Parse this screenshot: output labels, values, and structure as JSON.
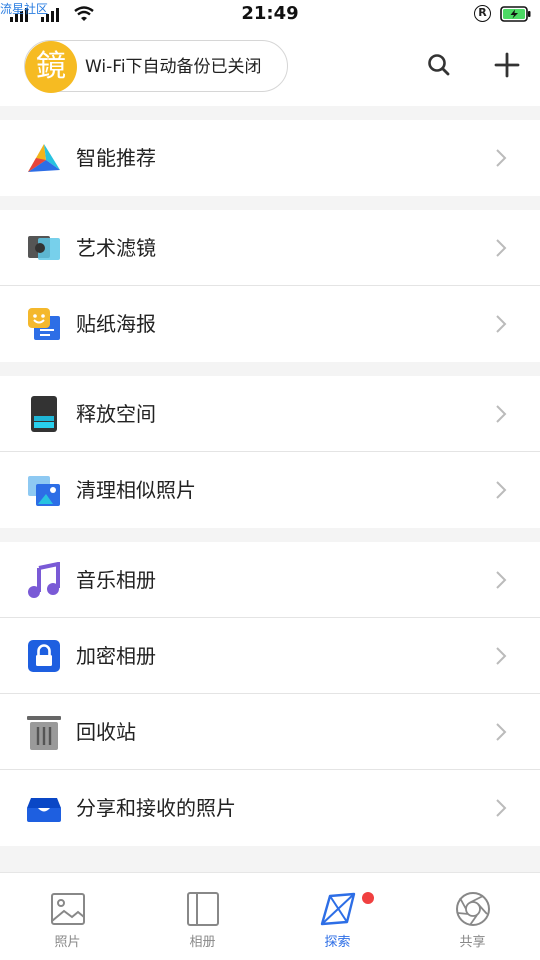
{
  "watermark": "流星社区",
  "status_bar": {
    "time": "21:49",
    "registered_mark": "R"
  },
  "header": {
    "avatar_char": "鏡",
    "backup_status": "Wi-Fi下自动备份已关闭",
    "search_icon": "search-icon",
    "add_icon": "plus-icon"
  },
  "groups": [
    {
      "items": [
        {
          "label": "智能推荐",
          "icon": "smart-recommend-icon"
        }
      ]
    },
    {
      "items": [
        {
          "label": "艺术滤镜",
          "icon": "art-filter-icon"
        },
        {
          "label": "贴纸海报",
          "icon": "sticker-poster-icon"
        }
      ]
    },
    {
      "items": [
        {
          "label": "释放空间",
          "icon": "free-space-icon"
        },
        {
          "label": "清理相似照片",
          "icon": "clean-similar-photos-icon"
        }
      ]
    },
    {
      "items": [
        {
          "label": "音乐相册",
          "icon": "music-album-icon"
        },
        {
          "label": "加密相册",
          "icon": "lock-album-icon"
        },
        {
          "label": "回收站",
          "icon": "trash-icon"
        },
        {
          "label": "分享和接收的照片",
          "icon": "inbox-tray-icon"
        }
      ]
    }
  ],
  "tabs": [
    {
      "label": "照片",
      "icon": "photo-icon",
      "active": false
    },
    {
      "label": "相册",
      "icon": "album-icon",
      "active": false
    },
    {
      "label": "探索",
      "icon": "explore-icon",
      "active": true,
      "badge": true
    },
    {
      "label": "共享",
      "icon": "shutter-icon",
      "active": false
    }
  ],
  "colors": {
    "accent": "#2d6ee6",
    "avatar": "#f6bb22",
    "badge": "#f04040",
    "battery": "#4cd964"
  }
}
